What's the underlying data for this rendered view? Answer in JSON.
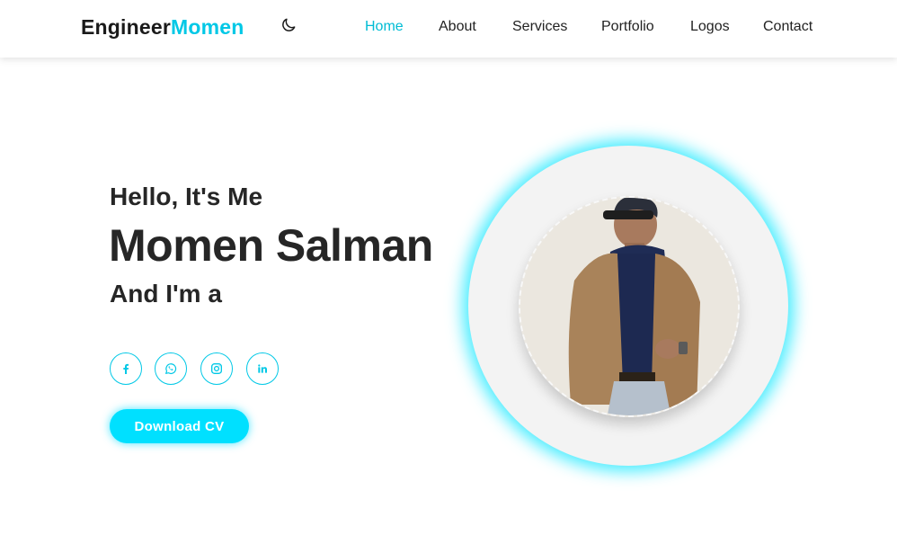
{
  "navbar": {
    "brand_part1": "Engineer",
    "brand_part2": "Momen",
    "theme_icon": "moon-icon",
    "links": [
      {
        "label": "Home",
        "active": true
      },
      {
        "label": "About",
        "active": false
      },
      {
        "label": "Services",
        "active": false
      },
      {
        "label": "Portfolio",
        "active": false
      },
      {
        "label": "Logos",
        "active": false
      },
      {
        "label": "Contact",
        "active": false
      }
    ]
  },
  "hero": {
    "greeting": "Hello, It's Me",
    "name": "Momen Salman",
    "role_prefix": "And I'm a",
    "social_icons": [
      "facebook-icon",
      "whatsapp-icon",
      "instagram-icon",
      "linkedin-icon"
    ],
    "cta_label": "Download CV"
  },
  "colors": {
    "accent": "#00c8e6",
    "button": "#00e0ff",
    "text": "#262626"
  }
}
